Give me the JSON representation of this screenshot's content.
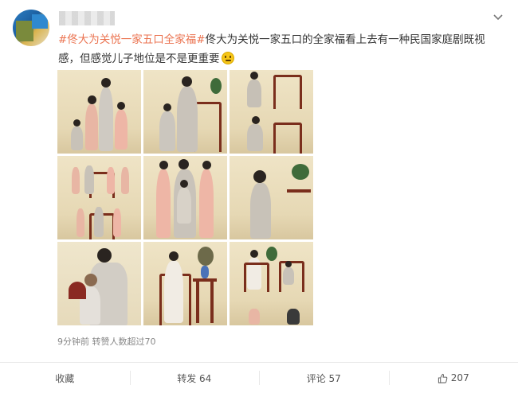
{
  "post": {
    "text_parts": [
      {
        "text": "#佟大为关悦一家五口全家福#",
        "kind": "topic"
      },
      {
        "text": "佟大为关悦一家五口的全家福看上去有一种民国家庭剧既视感，但感觉儿子地位是不是更重要",
        "kind": "plain"
      }
    ],
    "emoji": "smiling-face-emoji",
    "meta": "9分钟前 转赞人数超过70"
  },
  "photos": [
    {
      "name": "photo-1",
      "scene": "family-standing"
    },
    {
      "name": "photo-2",
      "scene": "father-son-seated"
    },
    {
      "name": "photo-3",
      "scene": "family-with-chairs"
    },
    {
      "name": "photo-4",
      "scene": "family-group-wide"
    },
    {
      "name": "photo-5",
      "scene": "family-close"
    },
    {
      "name": "photo-6",
      "scene": "boy-standing"
    },
    {
      "name": "photo-7",
      "scene": "father-holding-son"
    },
    {
      "name": "photo-8",
      "scene": "mother-seated"
    },
    {
      "name": "photo-9",
      "scene": "room-wide"
    }
  ],
  "actions": {
    "collect": "收藏",
    "repost": "转发 64",
    "comment": "评论 57",
    "like": "207"
  },
  "colors": {
    "topic": "#eb7350",
    "text": "#333333",
    "meta": "#888888",
    "divider": "#e8e8e8"
  }
}
